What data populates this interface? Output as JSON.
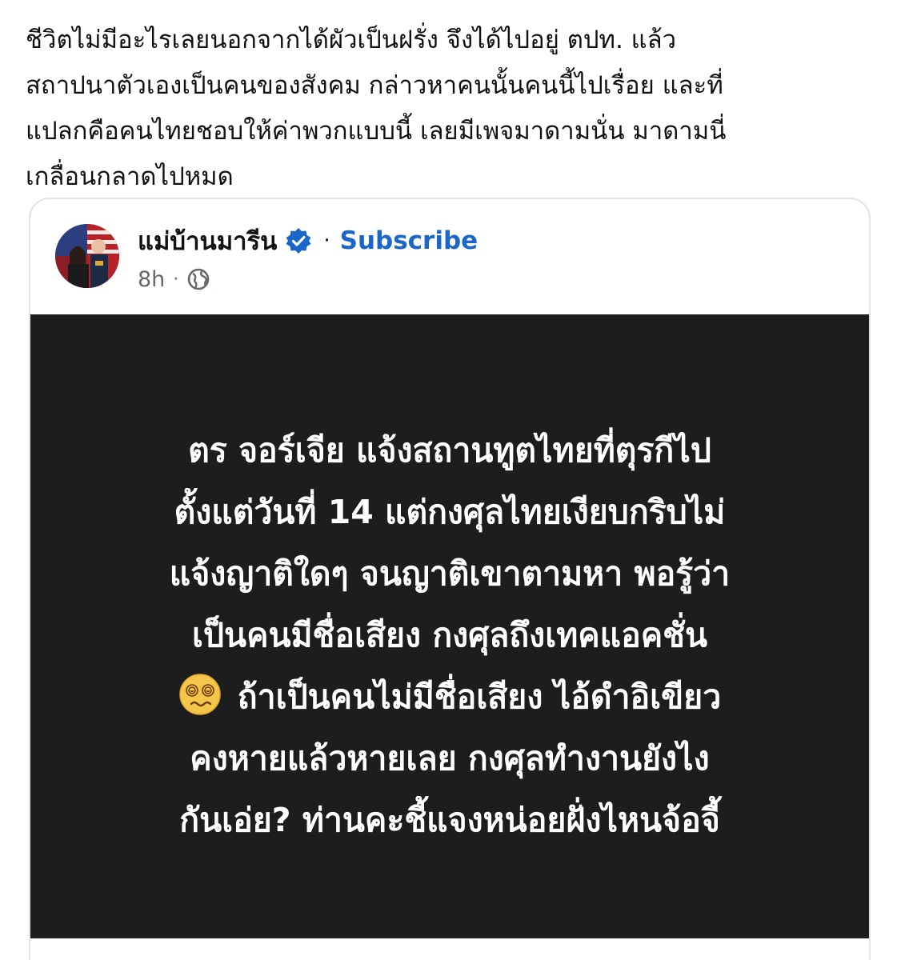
{
  "post": {
    "text_lines": [
      "ชีวิตไม่มีอะไรเลยนอกจากได้ผัวเป็นฝรั่ง จึงได้ไปอยู่ ตปท. แล้ว",
      "สถาปนาตัวเองเป็นคนของสังคม กล่าวหาคนนั้นคนนี้ไปเรื่อย และที่",
      "แปลกคือคนไทยชอบให้ค่าพวกแบบนี้ เลยมีเพจมาดามนั่น มาดามนี่",
      "เกลื่อนกลาดไปหมด"
    ]
  },
  "shared_post": {
    "author_name": "แม่บ้านมารีน",
    "separator": "·",
    "subscribe_label": "Subscribe",
    "time": "8h",
    "meta_separator": "·",
    "icons": {
      "verified": "verified-badge-icon",
      "privacy": "globe-icon",
      "emoji": "woozy-face-emoji"
    },
    "colors": {
      "subscribe": "#1b66c9",
      "media_background": "#1d1d1d",
      "verified": "#1b66c9"
    },
    "media_text_lines": [
      "ตร จอร์เจีย แจ้งสถานทูตไทยที่ตุรกีไป",
      "ตั้งแต่วันที่ 14 แต่กงศุลไทยเงียบกริบไม่",
      "แจ้งญาติใดๆ จนญาติเขาตามหา พอรู้ว่า",
      "เป็นคนมีชื่อเสียง กงศุลถึงเทคแอคชั่น",
      "ถ้าเป็นคนไม่มีชื่อเสียง ไอ้ดำอิเขียว",
      "คงหายแล้วหายเลย กงศุลทำงานยังไง",
      "กันเอ่ย? ท่านคะชี้แจงหน่อยฝั่งไหนจ้อจี้"
    ]
  }
}
